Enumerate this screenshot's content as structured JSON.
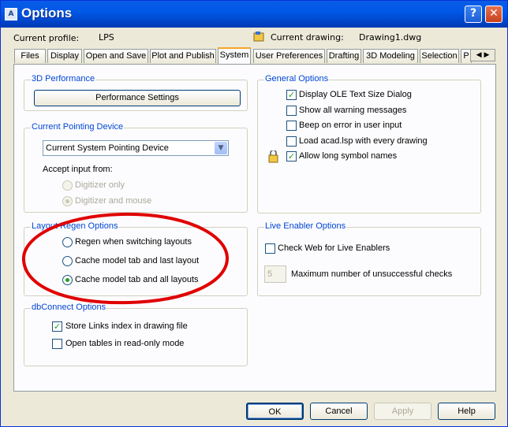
{
  "window": {
    "title": "Options",
    "help_label": "?",
    "close_label": "✕",
    "icon": "autocad-icon"
  },
  "header": {
    "profile_label": "Current profile:",
    "profile_value": "LPS",
    "drawing_label": "Current drawing:",
    "drawing_value": "Drawing1.dwg"
  },
  "tabs": [
    "Files",
    "Display",
    "Open and Save",
    "Plot and Publish",
    "System",
    "User Preferences",
    "Drafting",
    "3D Modeling",
    "Selection",
    "P"
  ],
  "active_tab": "System",
  "perf": {
    "title": "3D Performance",
    "button": "Performance Settings"
  },
  "pointing": {
    "title": "Current Pointing Device",
    "selected": "Current System Pointing Device",
    "accept_label": "Accept input from:",
    "options": [
      "Digitizer only",
      "Digitizer and mouse"
    ],
    "selected_option": "Digitizer and mouse"
  },
  "regen": {
    "title": "Layout Regen Options",
    "options": [
      "Regen when switching layouts",
      "Cache model tab and last layout",
      "Cache model tab and all layouts"
    ],
    "selected_option": "Cache model tab and all layouts"
  },
  "dbconnect": {
    "title": "dbConnect Options",
    "items": [
      {
        "label": "Store Links index in drawing file",
        "checked": true
      },
      {
        "label": "Open tables in read-only mode",
        "checked": false
      }
    ]
  },
  "general": {
    "title": "General Options",
    "items": [
      {
        "label": "Display OLE Text Size Dialog",
        "checked": true
      },
      {
        "label": "Show all warning messages",
        "checked": false
      },
      {
        "label": "Beep on error in user input",
        "checked": false
      },
      {
        "label": "Load acad.lsp with every drawing",
        "checked": false
      },
      {
        "label": "Allow long symbol names",
        "checked": true
      }
    ]
  },
  "live": {
    "title": "Live Enabler Options",
    "check_label": "Check Web for Live Enablers",
    "checked": false,
    "max_value": "5",
    "max_label": "Maximum number of unsuccessful checks"
  },
  "footer": {
    "ok": "OK",
    "cancel": "Cancel",
    "apply": "Apply",
    "help": "Help"
  },
  "annotation": {
    "color": "#e00000"
  }
}
